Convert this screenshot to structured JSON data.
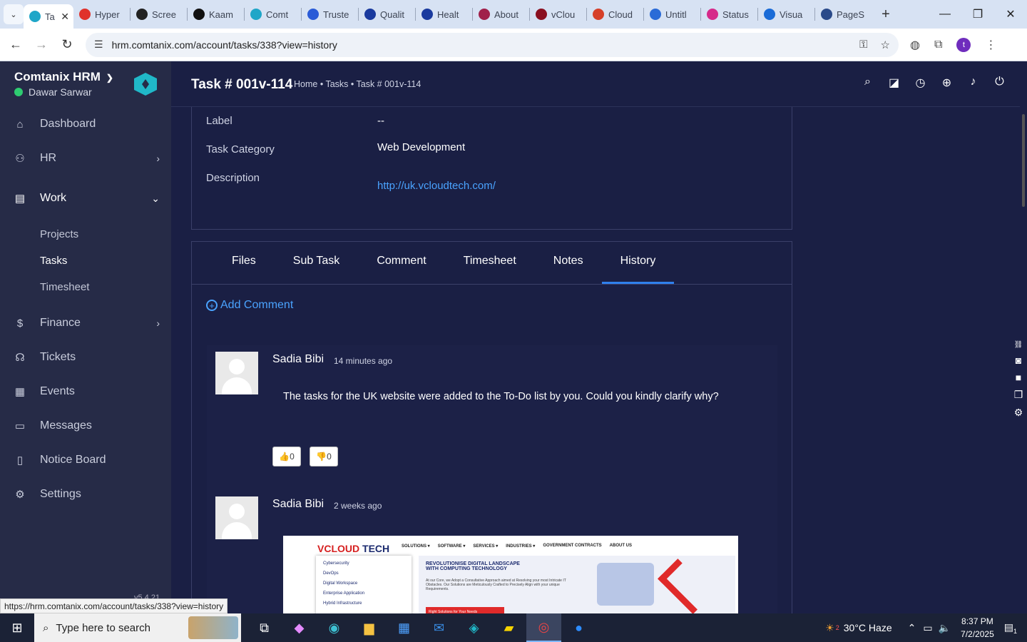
{
  "browser": {
    "tabs": [
      {
        "label": "Ta",
        "icon_color": "#1fa6c8",
        "active": true
      },
      {
        "label": "Hyper",
        "icon_color": "#e0312b"
      },
      {
        "label": "Scree",
        "icon_color": "#222222"
      },
      {
        "label": "Kaam",
        "icon_color": "#111111"
      },
      {
        "label": "Comt",
        "icon_color": "#1fa6c8"
      },
      {
        "label": "Truste",
        "icon_color": "#2a5bd7"
      },
      {
        "label": "Qualit",
        "icon_color": "#1a3a9e"
      },
      {
        "label": "Healt",
        "icon_color": "#1a3a9e"
      },
      {
        "label": "About",
        "icon_color": "#a0204a"
      },
      {
        "label": "vClou",
        "icon_color": "#8a1020"
      },
      {
        "label": "Cloud",
        "icon_color": "#d6402a"
      },
      {
        "label": "Untitl",
        "icon_color": "#2a6bd7"
      },
      {
        "label": "Status",
        "icon_color": "#d62a8a"
      },
      {
        "label": "Visua",
        "icon_color": "#1a6bd7"
      },
      {
        "label": "PageS",
        "icon_color": "#2a4a8a"
      }
    ],
    "url": "hrm.comtanix.com/account/tasks/338?view=history",
    "profile_initial": "t",
    "status_url": "https://hrm.comtanix.com/account/tasks/338?view=history"
  },
  "sidebar": {
    "brand": "Comtanix HRM",
    "user": "Dawar Sarwar",
    "items": [
      {
        "label": "Dashboard",
        "icon": "home-icon"
      },
      {
        "label": "HR",
        "icon": "users-icon"
      },
      {
        "label": "Work",
        "icon": "briefcase-icon"
      },
      {
        "label": "Finance",
        "icon": "dollar-icon"
      },
      {
        "label": "Tickets",
        "icon": "headset-icon"
      },
      {
        "label": "Events",
        "icon": "calendar-icon"
      },
      {
        "label": "Messages",
        "icon": "message-icon"
      },
      {
        "label": "Notice Board",
        "icon": "clipboard-icon"
      },
      {
        "label": "Settings",
        "icon": "gear-icon"
      }
    ],
    "work_sub": [
      "Projects",
      "Tasks",
      "Timesheet"
    ],
    "version": "v5.4.21"
  },
  "header": {
    "title": "Task # 001v-114",
    "breadcrumb": "Home • Tasks • Task # 001v-114"
  },
  "details": {
    "label_key": "Label",
    "label_val": "--",
    "category_key": "Task Category",
    "category_val": "Web Development",
    "description_key": "Description",
    "description_val": "http://uk.vcloudtech.com/"
  },
  "tabs": [
    "Files",
    "Sub Task",
    "Comment",
    "Timesheet",
    "Notes",
    "History"
  ],
  "add_comment": "Add Comment",
  "comments": [
    {
      "author": "Sadia Bibi",
      "time": "14 minutes ago",
      "text": "The tasks for the UK website were added to the To-Do list by you. Could you kindly clarify why?",
      "likes": "0",
      "dislikes": "0"
    },
    {
      "author": "Sadia Bibi",
      "time": "2 weeks ago"
    }
  ],
  "screenshot_preview": {
    "brand_a": "VCLOUD",
    "brand_b": "TECH",
    "nav": [
      "SOLUTIONS ▾",
      "SOFTWARE ▾",
      "SERVICES ▾",
      "INDUSTRIES ▾",
      "GOVERNMENT CONTRACTS",
      "ABOUT US"
    ],
    "menu": [
      "Cybersecurity",
      "DevOps",
      "Digital Workspace",
      "Enterprise Application",
      "Hybrid Infrastructure"
    ],
    "headline": "REVOLUTIONISE DIGITAL LANDSCAPE WITH COMPUTING TECHNOLOGY",
    "body": "At our Core, we Adopt a Consultative Approach aimed at Resolving your most Intricate IT Obstacles. Our Solutions are Meticulously Crafted to Precisely Align with your unique Requirements.",
    "cta": "Right Solutions for Your Needs"
  },
  "taskbar": {
    "search_placeholder": "Type here to search",
    "weather": "30°C  Haze",
    "weather_badge": "2",
    "time": "8:37 PM",
    "date": "7/2/2025",
    "notif_count": "1"
  }
}
